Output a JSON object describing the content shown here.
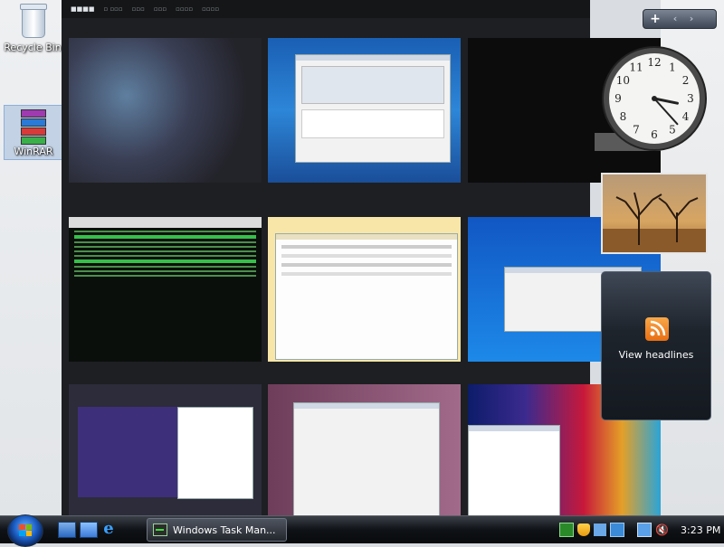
{
  "desktop": {
    "icons": [
      {
        "label": "Recycle Bin"
      },
      {
        "label": "WinRAR"
      }
    ]
  },
  "sidebar": {
    "add_label": "+",
    "prev_label": "‹",
    "next_label": "›",
    "clock": {
      "hour": 3,
      "minute": 23,
      "numerals": [
        "12",
        "1",
        "2",
        "3",
        "4",
        "5",
        "6",
        "7",
        "8",
        "9",
        "10",
        "11"
      ]
    },
    "feed": {
      "label": "View headlines"
    }
  },
  "taskbar": {
    "start_icon": "windows-flag-icon",
    "quick_launch": [
      "show-desktop-icon",
      "switch-windows-icon",
      "internet-explorer-icon"
    ],
    "task_button_label": "Windows Task Man...",
    "clock": "3:23 PM"
  },
  "colors": {
    "taskbar": "#0f1216",
    "accent": "#2d86d8",
    "feed_orange": "#e86e12"
  }
}
